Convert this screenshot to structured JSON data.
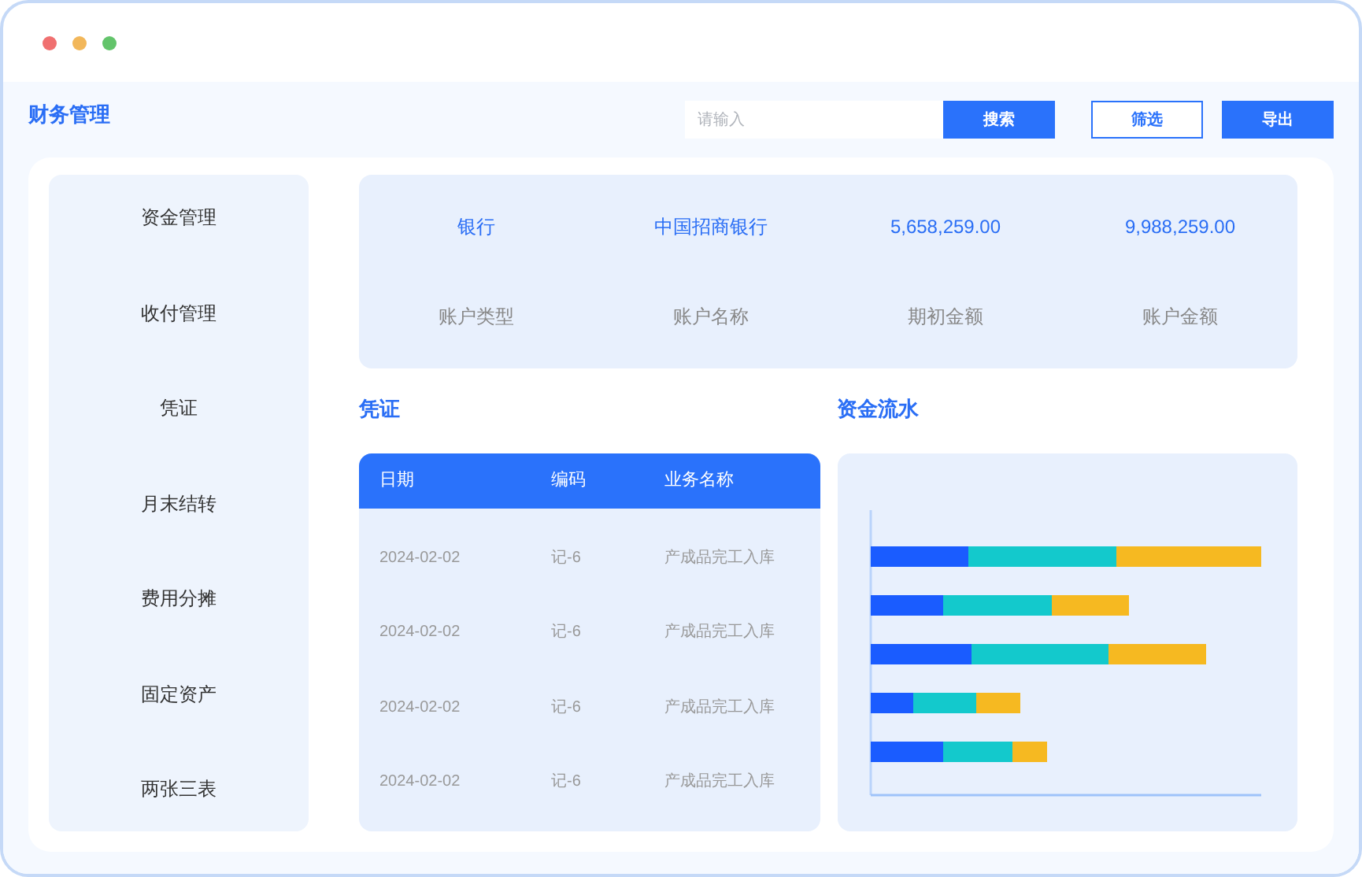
{
  "app": {
    "title": "财务管理"
  },
  "toolbar": {
    "search": {
      "placeholder": "请输入"
    },
    "buttons": [
      {
        "label": "搜索",
        "kind": "primary"
      },
      {
        "label": "筛选",
        "kind": "outline"
      },
      {
        "label": "导出",
        "kind": "primary"
      }
    ]
  },
  "sidebar": {
    "items": [
      {
        "label": "资金管理"
      },
      {
        "label": "收付管理"
      },
      {
        "label": "凭证"
      },
      {
        "label": "月末结转"
      },
      {
        "label": "费用分摊"
      },
      {
        "label": "固定资产"
      },
      {
        "label": "两张三表"
      }
    ]
  },
  "summary": [
    {
      "value": "银行",
      "label": "账户类型"
    },
    {
      "value": "中国招商银行",
      "label": "账户名称"
    },
    {
      "value": "5,658,259.00",
      "label": "期初金额"
    },
    {
      "value": "9,988,259.00",
      "label": "账户金额"
    }
  ],
  "voucher": {
    "title": "凭证",
    "columns": [
      "日期",
      "编码",
      "业务名称"
    ],
    "rows": [
      [
        "2024-02-02",
        "记-6",
        "产成品完工入库"
      ],
      [
        "2024-02-02",
        "记-6",
        "产成品完工入库"
      ],
      [
        "2024-02-02",
        "记-6",
        "产成品完工入库"
      ],
      [
        "2024-02-02",
        "记-6",
        "产成品完工入库"
      ]
    ]
  },
  "cashflow": {
    "title": "资金流水"
  }
}
